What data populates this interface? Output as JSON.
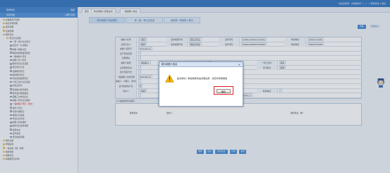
{
  "topbar": {
    "user_info": "欢迎您使用：办税服务厅（…）  ▾  密码修改  ▾  退出"
  },
  "sidebar": {
    "header": "菜单列表",
    "header_right": "收起",
    "subheader": "系统功能",
    "subheader_right": "+展开全部",
    "items": [
      {
        "label": "办税服务厅管理",
        "level": 1
      },
      {
        "label": "综合查询管理",
        "level": 1
      },
      {
        "label": "发票管理",
        "level": 1
      },
      {
        "label": "征收管理",
        "level": 1
      },
      {
        "label": "税务登记",
        "level": 1
      },
      {
        "label": "登记信息采集",
        "level": 2
      },
      {
        "label": "一照一码户信息登记",
        "level": 3
      },
      {
        "label": "多证合一信息确认",
        "level": 3
      },
      {
        "label": "纳税人税种认定",
        "level": 3
      },
      {
        "label": "跨区域涉税事项报告",
        "level": 3
      },
      {
        "label": "一般纳税人登记",
        "level": 3
      },
      {
        "label": "扣缴义务人登记",
        "level": 3
      },
      {
        "label": "税务登记信息变更",
        "level": 3
      },
      {
        "label": "非正常户认定",
        "level": 3
      },
      {
        "label": "注销税务登记",
        "level": 3
      },
      {
        "label": "临时税务登记",
        "level": 3
      },
      {
        "label": "外出经营报验登记",
        "level": 3
      },
      {
        "label": "个体工商户信息采集",
        "level": 3
      },
      {
        "label": "停复业登记",
        "level": 3
      },
      {
        "label": "存款账户账号报告",
        "level": 3
      },
      {
        "label": "财务会计制度备案",
        "level": 3
      },
      {
        "label": "银税三方协议信息",
        "level": 3
      },
      {
        "label": "纳税人登记信息维护",
        "level": 3
      },
      {
        "label": "一般纳税人登记（新办）",
        "level": 3,
        "highlight": true
      },
      {
        "label": "自然人登记",
        "level": 3
      },
      {
        "label": "代扣代缴登记",
        "level": 3
      },
      {
        "label": "税源信息采集",
        "level": 3
      },
      {
        "label": "登记信息查询",
        "level": 3
      },
      {
        "label": "纳税人状态维护",
        "level": 3
      },
      {
        "label": "税务登记证件管理",
        "level": 3
      },
      {
        "label": "证照补办",
        "level": 3
      },
      {
        "label": "证件验旧",
        "level": 3
      },
      {
        "label": "登记档案管理",
        "level": 3
      },
      {
        "label": "税务注销",
        "level": 1
      },
      {
        "label": "申报征收",
        "level": 1
      },
      {
        "label": "一般征收（税）管理",
        "level": 1
      },
      {
        "label": "税收优惠",
        "level": 1
      },
      {
        "label": "税收票证",
        "level": 1
      },
      {
        "label": "纳税服务及咨询",
        "level": 1
      }
    ]
  },
  "tabs": [
    "首页",
    "新办纳税人套餐业务",
    "一般纳税人信息"
  ],
  "steps": [
    "新办纳税人信息登记",
    "税（费）种认定信息",
    "增值税一般纳税人登记"
  ],
  "top_buttons": [
    "查看",
    "批量提交"
  ],
  "form": {
    "rows": [
      {
        "cells": [
          [
            "lbl",
            "纳税人名称"
          ],
          [
            "val",
            "一保存"
          ],
          [
            "lbl",
            "证件类型代码"
          ],
          [
            "val",
            "居民身份证"
          ],
          [
            "lbl",
            "证件号码"
          ],
          [
            "val",
            "140621198707270004"
          ],
          [
            "lbl",
            "联系电话"
          ],
          [
            "val",
            "15847732384"
          ]
        ]
      },
      {
        "cells": [
          [
            "lbl",
            "法定代表人"
          ],
          [
            "val",
            "一保存"
          ],
          [
            "lbl",
            "证件类型代码"
          ],
          [
            "val",
            "居民身份证"
          ],
          [
            "lbl",
            "证件号码"
          ],
          [
            "val",
            "140621198707270004"
          ],
          [
            "lbl",
            "联系电话"
          ],
          [
            "val",
            "15847732384"
          ]
        ]
      },
      {
        "cells": [
          [
            "lbl",
            "纳税人识别号"
          ],
          [
            "val",
            "2016-08-11"
          ]
        ]
      },
      {
        "cells": [
          [
            "lbl",
            "生产经营范围"
          ],
          [
            "val",
            ""
          ]
        ]
      },
      {
        "cells": [
          [
            "lbl",
            "注册地址"
          ],
          [
            "val",
            ""
          ]
        ]
      },
      {
        "cells": [
          [
            "lbl",
            "纳税人类别"
          ],
          [
            "val",
            "一般纳税人"
          ],
          [
            "lbl",
            "登记注册类型"
          ],
          [
            "val",
            ""
          ],
          [
            "lbl",
            "个体工商户"
          ],
          [
            "val",
            "其他"
          ]
        ]
      },
      {
        "cells": [
          [
            "lbl",
            "主管税务机关"
          ],
          [
            "val",
            ""
          ],
          [
            "lbl",
            "主管税务所"
          ],
          [
            "val",
            ""
          ],
          [
            "lbl",
            "登记机关"
          ],
          [
            "val",
            "其他"
          ]
        ]
      },
      {
        "cells": [
          [
            "lbl",
            "会计核算方式"
          ],
          [
            "val",
            ""
          ]
        ]
      },
      {
        "cells": [
          [
            "lbl",
            "一般纳税人生效日期"
          ],
          [
            "val",
            "2016-08-11"
          ]
        ]
      },
      {
        "cells": [
          [
            "lbl",
            "纳税人、代理人、财务负责人信息"
          ],
          [
            "val",
            ""
          ]
        ]
      },
      {
        "cells": [
          [
            "lbl",
            "会计档案电子化"
          ],
          [
            "val",
            "否"
          ],
          [
            "lbl",
            "是否为一般纳税人"
          ],
          [
            "val",
            "否"
          ]
        ]
      },
      {
        "cells": [
          [
            "lbl",
            "经办人"
          ],
          [
            "val",
            "一保存"
          ],
          [
            "lbl",
            "证件类型代码"
          ],
          [
            "val",
            "一保存"
          ],
          [
            "lbl",
            "联系电话"
          ],
          [
            "val",
            ""
          ]
        ]
      },
      {
        "cells": [
          [
            "lbl",
            ""
          ],
          [
            "val",
            ""
          ],
          [
            "lbl",
            "受理日期"
          ],
          [
            "val",
            "2016-08-11"
          ]
        ]
      }
    ]
  },
  "section_label": "以下由税务机关填写",
  "office_label": "税务机关",
  "handler_label": "经办人",
  "sign_label": "税务机关（章）",
  "bottom_buttons": [
    "保存",
    "提交",
    "检查信息",
    "打印",
    "关闭"
  ],
  "modal": {
    "title": "新办纳税人信息",
    "close_glyph": "✕",
    "message": "提交成功！前往税务机关办理业务，请及时查收短信",
    "ok_label": "确定"
  }
}
